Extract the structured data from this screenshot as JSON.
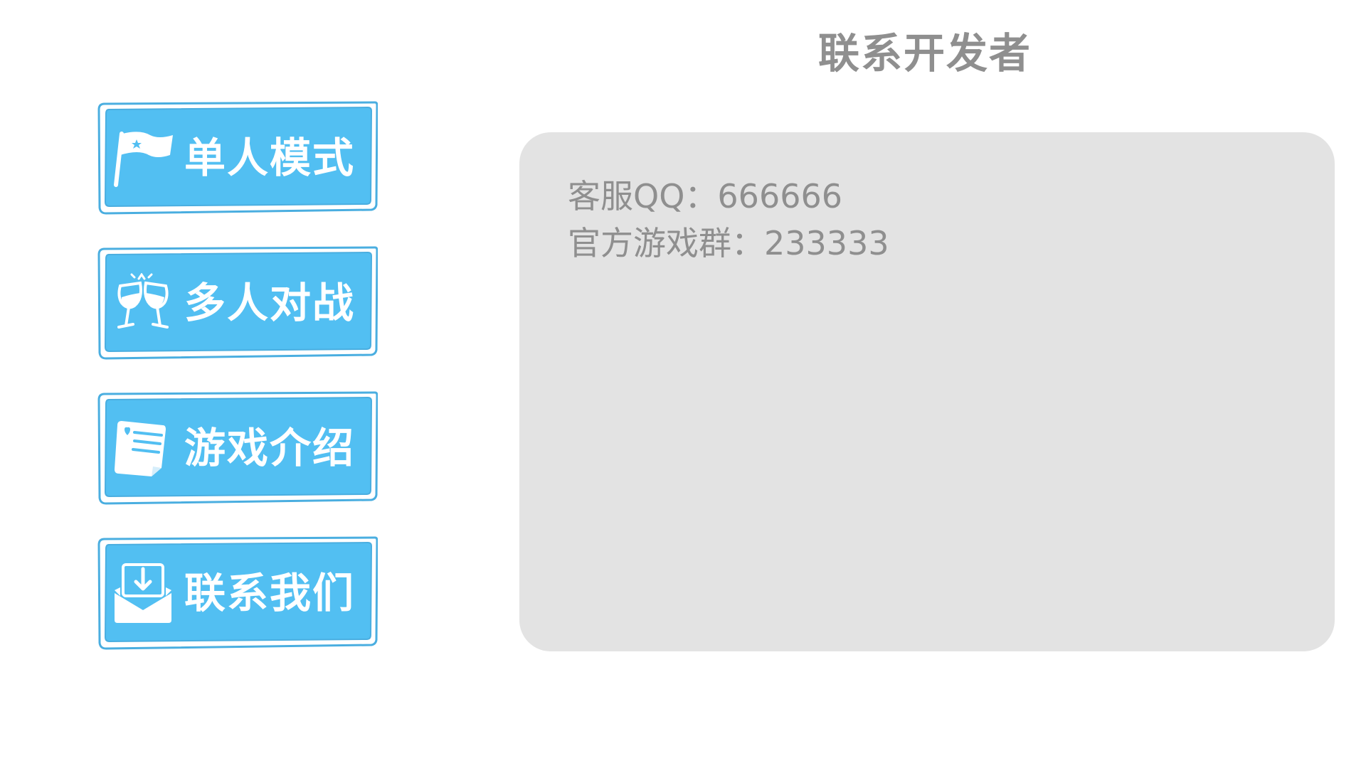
{
  "menu": {
    "items": [
      {
        "id": "single",
        "label": "单人模式",
        "icon": "flag-icon"
      },
      {
        "id": "multi",
        "label": "多人对战",
        "icon": "cheers-glasses-icon"
      },
      {
        "id": "intro",
        "label": "游戏介绍",
        "icon": "document-icon"
      },
      {
        "id": "contact",
        "label": "联系我们",
        "icon": "inbox-download-icon"
      }
    ]
  },
  "panel": {
    "title": "联系开发者",
    "lines": [
      "客服QQ：666666",
      "官方游戏群：233333"
    ]
  },
  "colors": {
    "button_fill": "#52bff2",
    "button_border": "#4aaee0",
    "button_text": "#ffffff",
    "card_bg": "#e3e3e3",
    "text_gray": "#8f8f8f"
  }
}
